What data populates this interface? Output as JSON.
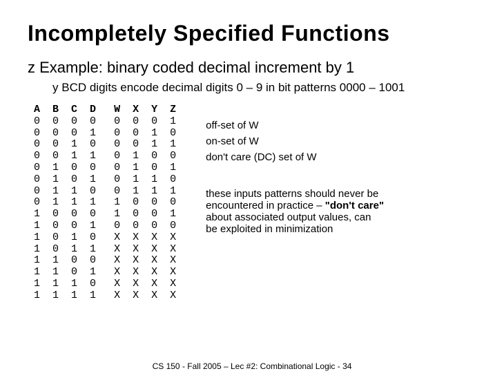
{
  "title": "Incompletely Specified Functions",
  "bullet1": {
    "mark": "z",
    "text": "Example: binary coded decimal increment by 1"
  },
  "bullet2": {
    "mark": "y",
    "text": "BCD digits encode decimal digits 0 – 9 in bit patterns 0000 – 1001"
  },
  "table": {
    "headers_in": [
      "A",
      "B",
      "C",
      "D"
    ],
    "headers_out": [
      "W",
      "X",
      "Y",
      "Z"
    ],
    "rows": [
      {
        "in": [
          "0",
          "0",
          "0",
          "0"
        ],
        "out": [
          "0",
          "0",
          "0",
          "1"
        ]
      },
      {
        "in": [
          "0",
          "0",
          "0",
          "1"
        ],
        "out": [
          "0",
          "0",
          "1",
          "0"
        ]
      },
      {
        "in": [
          "0",
          "0",
          "1",
          "0"
        ],
        "out": [
          "0",
          "0",
          "1",
          "1"
        ]
      },
      {
        "in": [
          "0",
          "0",
          "1",
          "1"
        ],
        "out": [
          "0",
          "1",
          "0",
          "0"
        ]
      },
      {
        "in": [
          "0",
          "1",
          "0",
          "0"
        ],
        "out": [
          "0",
          "1",
          "0",
          "1"
        ]
      },
      {
        "in": [
          "0",
          "1",
          "0",
          "1"
        ],
        "out": [
          "0",
          "1",
          "1",
          "0"
        ]
      },
      {
        "in": [
          "0",
          "1",
          "1",
          "0"
        ],
        "out": [
          "0",
          "1",
          "1",
          "1"
        ]
      },
      {
        "in": [
          "0",
          "1",
          "1",
          "1"
        ],
        "out": [
          "1",
          "0",
          "0",
          "0"
        ]
      },
      {
        "in": [
          "1",
          "0",
          "0",
          "0"
        ],
        "out": [
          "1",
          "0",
          "0",
          "1"
        ]
      },
      {
        "in": [
          "1",
          "0",
          "0",
          "1"
        ],
        "out": [
          "0",
          "0",
          "0",
          "0"
        ]
      },
      {
        "in": [
          "1",
          "0",
          "1",
          "0"
        ],
        "out": [
          "X",
          "X",
          "X",
          "X"
        ]
      },
      {
        "in": [
          "1",
          "0",
          "1",
          "1"
        ],
        "out": [
          "X",
          "X",
          "X",
          "X"
        ]
      },
      {
        "in": [
          "1",
          "1",
          "0",
          "0"
        ],
        "out": [
          "X",
          "X",
          "X",
          "X"
        ]
      },
      {
        "in": [
          "1",
          "1",
          "0",
          "1"
        ],
        "out": [
          "X",
          "X",
          "X",
          "X"
        ]
      },
      {
        "in": [
          "1",
          "1",
          "1",
          "0"
        ],
        "out": [
          "X",
          "X",
          "X",
          "X"
        ]
      },
      {
        "in": [
          "1",
          "1",
          "1",
          "1"
        ],
        "out": [
          "X",
          "X",
          "X",
          "X"
        ]
      }
    ]
  },
  "annotations": {
    "off_set": "off-set of W",
    "on_set": "on-set of W",
    "dc_set": "don't care (DC) set of W",
    "note_pre": "these inputs patterns should never be encountered in practice – ",
    "note_bold": "\"don't care\"",
    "note_post": " about associated output values, can be exploited in minimization"
  },
  "footer": "CS 150 - Fall 2005 – Lec #2: Combinational Logic - 34"
}
